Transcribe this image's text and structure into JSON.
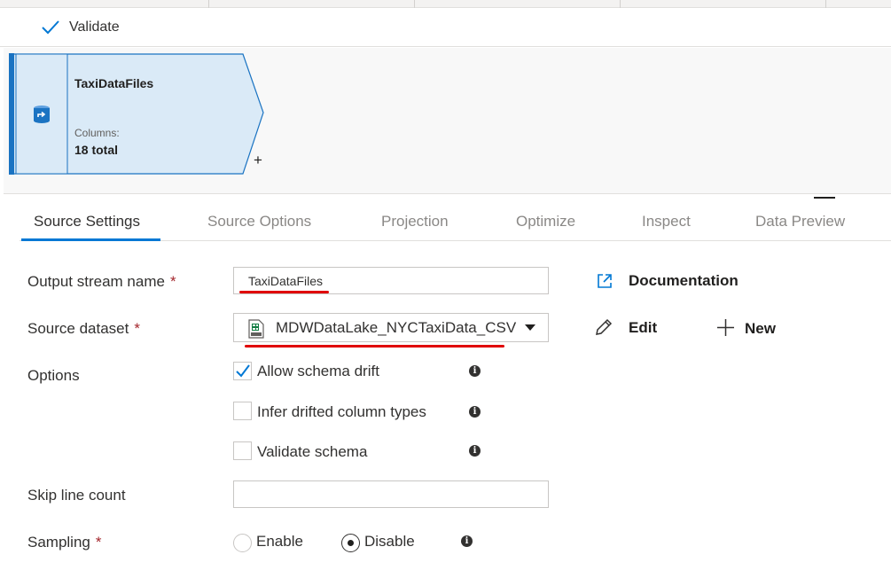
{
  "toolbar": {
    "validate_label": "Validate"
  },
  "node": {
    "title": "TaxiDataFiles",
    "columns_label": "Columns:",
    "columns_value": "18 total",
    "add_glyph": "+",
    "icon": "source-dataset-icon"
  },
  "tabs": [
    {
      "label": "Source Settings",
      "active": true
    },
    {
      "label": "Source Options",
      "active": false
    },
    {
      "label": "Projection",
      "active": false
    },
    {
      "label": "Optimize",
      "active": false
    },
    {
      "label": "Inspect",
      "active": false
    },
    {
      "label": "Data Preview",
      "active": false
    }
  ],
  "form": {
    "output_stream": {
      "label": "Output stream name",
      "required_mark": "*",
      "value": "TaxiDataFiles"
    },
    "source_dataset": {
      "label": "Source dataset",
      "required_mark": "*",
      "value": "MDWDataLake_NYCTaxiData_CSV",
      "icon": "csv-file-icon"
    },
    "options": {
      "label": "Options",
      "items": [
        {
          "label": "Allow schema drift",
          "checked": true
        },
        {
          "label": "Infer drifted column types",
          "checked": false
        },
        {
          "label": "Validate schema",
          "checked": false
        }
      ]
    },
    "skip_line_count": {
      "label": "Skip line count",
      "value": ""
    },
    "sampling": {
      "label": "Sampling",
      "required_mark": "*",
      "options": [
        {
          "label": "Enable",
          "selected": false
        },
        {
          "label": "Disable",
          "selected": true
        }
      ]
    }
  },
  "side_actions": {
    "documentation": "Documentation",
    "edit": "Edit",
    "new": "New"
  },
  "colors": {
    "accent": "#0078d4",
    "node_fill": "#daeaf7",
    "node_border": "#1a73c2",
    "annotation_red": "#e00000",
    "required": "#a4262c"
  }
}
